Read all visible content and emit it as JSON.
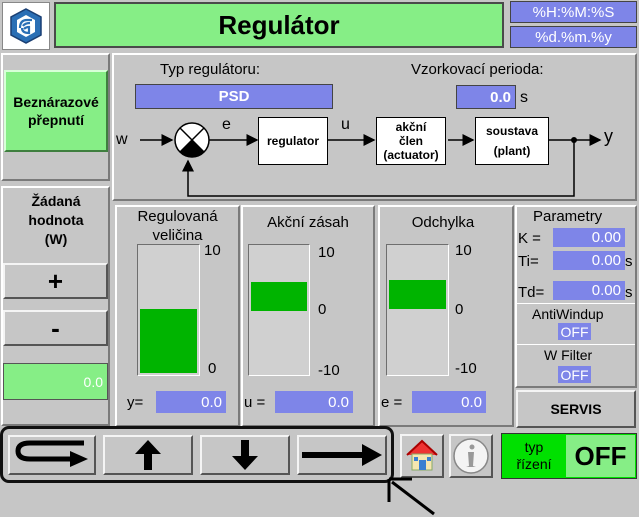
{
  "header": {
    "title": "Regulátor",
    "time_format": "%H:%M:%S",
    "date_format": "%d.%m.%y"
  },
  "left": {
    "bumpless_button": "Beznárazové\npřepnutí",
    "setpoint_label": "Žádaná\nhodnota\n(W)",
    "plus_label": "+",
    "minus_label": "-",
    "setpoint_value": "0.0"
  },
  "diagram": {
    "regulator_type_label": "Typ regulátoru:",
    "regulator_type_value": "PSD",
    "sample_period_label": "Vzorkovací perioda:",
    "sample_period_value": "0.0",
    "sample_period_unit": "s",
    "w": "w",
    "e": "e",
    "u": "u",
    "y": "y",
    "regulator_box": "regulator",
    "actuator_box": "akční\nčlen\n(actuator)",
    "plant_box": "soustava\n(plant)"
  },
  "gauges": [
    {
      "title": "Regulovaná\nveličina",
      "max": "10",
      "min": "0",
      "var": "y=",
      "value": "0.0",
      "level": 0.5
    },
    {
      "title": "Akční zásah",
      "max": "10",
      "mid": "0",
      "min": "-10",
      "var": "u =",
      "value": "0.0",
      "level": 0.5
    },
    {
      "title": "Odchylka",
      "max": "10",
      "mid": "0",
      "min": "-10",
      "var": "e =",
      "value": "0.0",
      "level": 0.5
    }
  ],
  "params": {
    "title": "Parametry",
    "k_label": "K =",
    "k_value": "0.00",
    "ti_label": "Ti=",
    "ti_value": "0.00",
    "ti_unit": "s",
    "td_label": "Td=",
    "td_value": "0.00",
    "td_unit": "s",
    "antiwindup_label": "AntiWindup",
    "antiwindup_value": "OFF",
    "wfilter_label": "W Filter",
    "wfilter_value": "OFF",
    "servis_label": "SERVIS"
  },
  "bottom": {
    "control_type_label": "typ\nřízení",
    "control_type_value": "OFF"
  },
  "colors": {
    "title_bg": "#86ee86",
    "field_bg": "#7e85e8",
    "bar_green": "#00b400",
    "off_bg": "#00e000"
  }
}
